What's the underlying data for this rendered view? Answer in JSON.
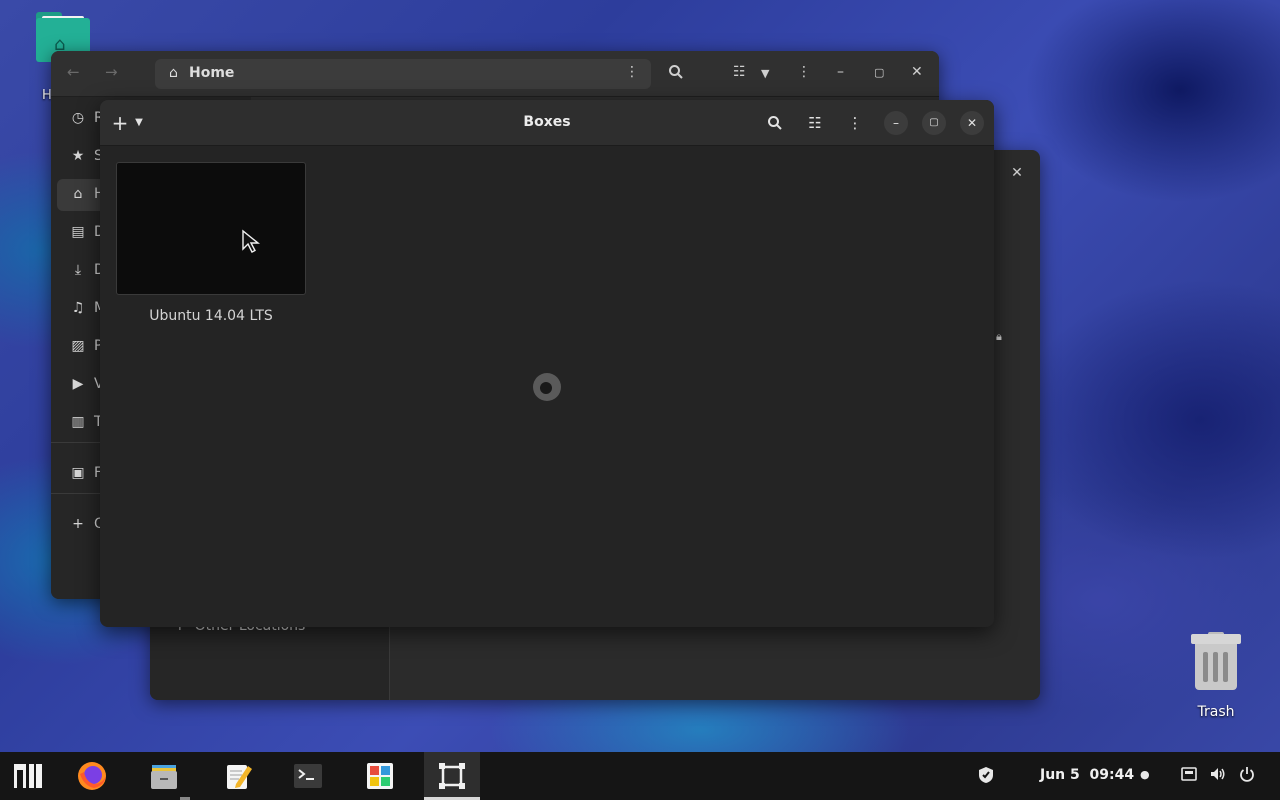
{
  "desktop": {
    "home_label": "H",
    "trash_label": "Trash"
  },
  "rear_window": {
    "other_locations": "Other Locations"
  },
  "files": {
    "path": "Home",
    "sidebar": [
      {
        "icon": "recent-icon",
        "label": "R",
        "glyph": "◷"
      },
      {
        "icon": "starred-icon",
        "label": "S",
        "glyph": "★"
      },
      {
        "icon": "home-icon",
        "label": "H",
        "glyph": "⌂"
      },
      {
        "icon": "documents-icon",
        "label": "D",
        "glyph": "▤"
      },
      {
        "icon": "downloads-icon",
        "label": "D",
        "glyph": "⤓"
      },
      {
        "icon": "music-icon",
        "label": "M",
        "glyph": "♫"
      },
      {
        "icon": "pictures-icon",
        "label": "P",
        "glyph": "▨"
      },
      {
        "icon": "videos-icon",
        "label": "V",
        "glyph": "▶"
      },
      {
        "icon": "trash-icon",
        "label": "T",
        "glyph": "▥"
      },
      {
        "icon": "floppy-icon",
        "label": "F",
        "glyph": "▣"
      },
      {
        "icon": "plus-icon",
        "label": "O",
        "glyph": "+"
      }
    ]
  },
  "boxes": {
    "title": "Boxes",
    "vm_name": "Ubuntu 14.04 LTS"
  },
  "taskbar": {
    "clock": "Jun 5  09:44"
  },
  "colors": {
    "accent_teal": "#23b096",
    "window_bg": "#242424",
    "taskbar_bg": "#151515"
  }
}
